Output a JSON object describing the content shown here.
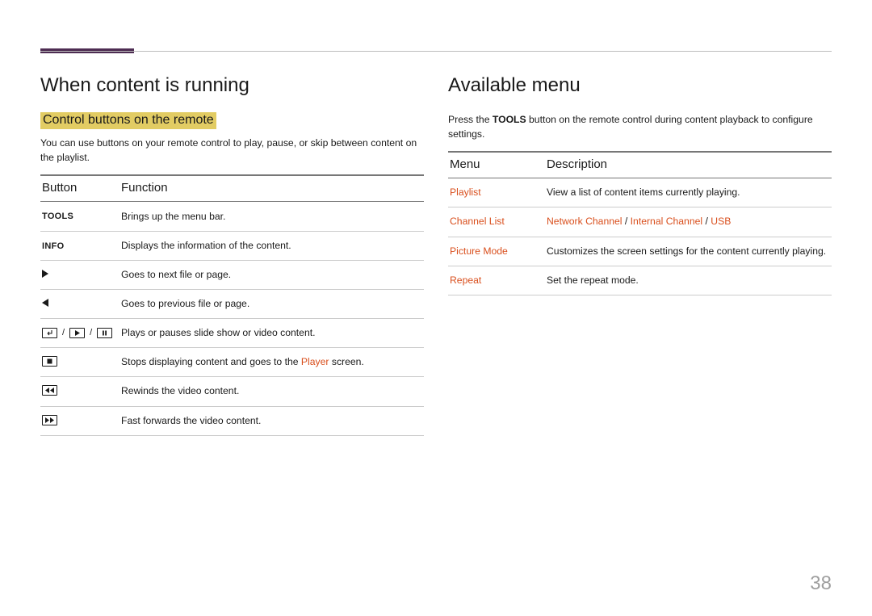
{
  "left": {
    "heading": "When content is running",
    "subheading": "Control buttons on the remote",
    "intro": "You can use buttons on your remote control to play, pause, or skip between content on the playlist.",
    "th1": "Button",
    "th2": "Function",
    "rows": {
      "r0": {
        "b": "TOOLS",
        "f": "Brings up the menu bar."
      },
      "r1": {
        "b": "INFO",
        "f": "Displays the information of the content."
      },
      "r2": {
        "f": "Goes to next file or page."
      },
      "r3": {
        "f": "Goes to previous file or page."
      },
      "r4": {
        "f": "Plays or pauses slide show or video content."
      },
      "r5": {
        "pre": "Stops displaying content and goes to the ",
        "link": "Player",
        "post": " screen."
      },
      "r6": {
        "f": "Rewinds the video content."
      },
      "r7": {
        "f": "Fast forwards the video content."
      }
    }
  },
  "right": {
    "heading": "Available menu",
    "intro_pre": "Press the ",
    "intro_bold": "TOOLS",
    "intro_post": " button on the remote control during content playback to configure settings.",
    "th1": "Menu",
    "th2": "Description",
    "rows": {
      "r0": {
        "m": "Playlist",
        "d": "View a list of content items currently playing."
      },
      "r1": {
        "m": "Channel List",
        "a": "Network Channel",
        "s1": " / ",
        "b": "Internal Channel",
        "s2": " / ",
        "c": "USB"
      },
      "r2": {
        "m": "Picture Mode",
        "d": "Customizes the screen settings for the content currently playing."
      },
      "r3": {
        "m": "Repeat",
        "d": "Set the repeat mode."
      }
    }
  },
  "pagenum": "38"
}
